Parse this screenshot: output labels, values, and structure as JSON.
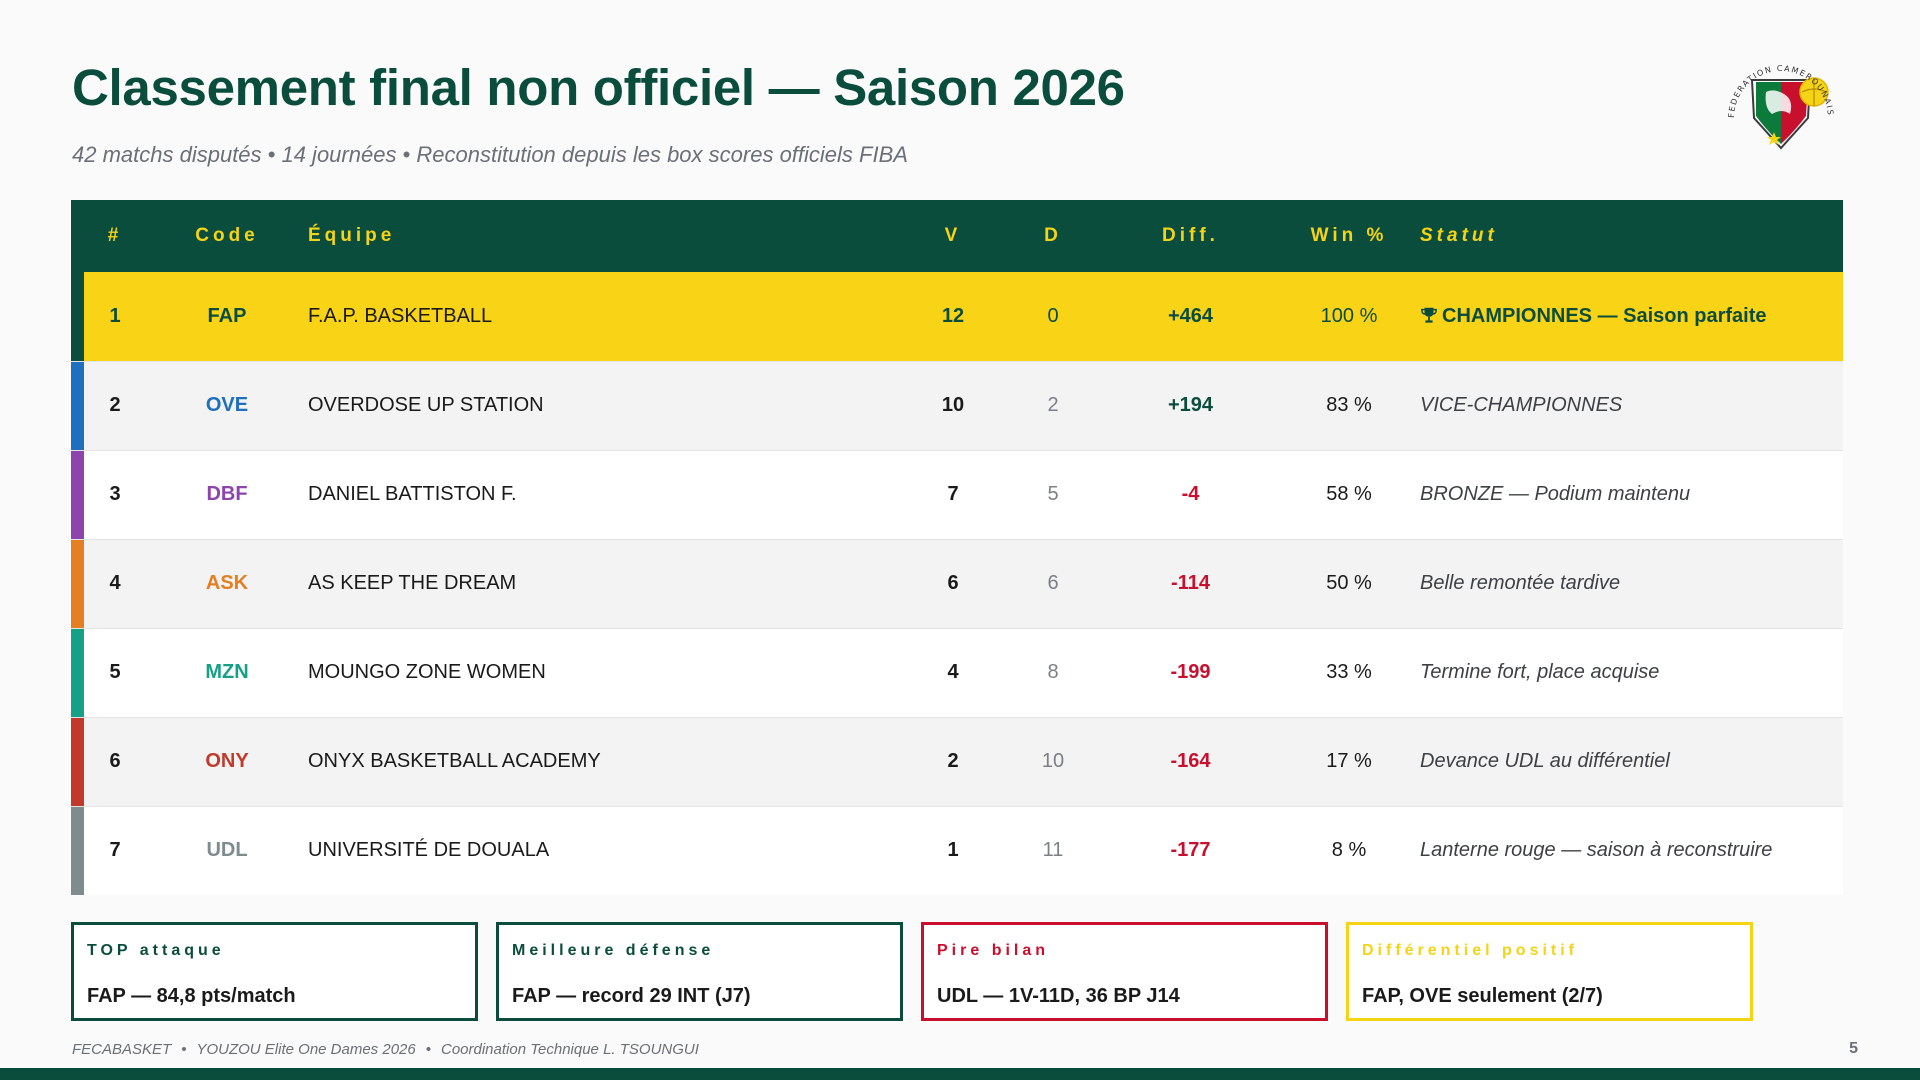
{
  "title": "Classement final non officiel — Saison 2026",
  "subtitle": "42 matchs disputés • 14 journées • Reconstitution depuis les box scores officiels FIBA",
  "logo": {
    "icon": "fecabasket-logo",
    "ring_text": "FEDERATION CAMEROUNAISE DE BASKETBALL",
    "colors": [
      "#0b7a3a",
      "#c8102e",
      "#f5d415"
    ]
  },
  "table": {
    "headers": {
      "rank": "#",
      "code": "Code",
      "team": "Équipe",
      "v": "V",
      "d": "D",
      "diff": "Diff.",
      "win": "Win %",
      "status": "Statut"
    },
    "rows": [
      {
        "rank": "1",
        "code": "FAP",
        "team": "F.A.P. BASKETBALL",
        "v": "12",
        "d": "0",
        "diff": "+464",
        "win": "100 %",
        "status": "CHAMPIONNES — Saison parfaite",
        "color": "#0b4d3c",
        "sign": "pos",
        "icon": "trophy-icon"
      },
      {
        "rank": "2",
        "code": "OVE",
        "team": "OVERDOSE UP STATION",
        "v": "10",
        "d": "2",
        "diff": "+194",
        "win": "83 %",
        "status": "VICE-CHAMPIONNES",
        "color": "#1f6fbf",
        "sign": "pos"
      },
      {
        "rank": "3",
        "code": "DBF",
        "team": "DANIEL BATTISTON F.",
        "v": "7",
        "d": "5",
        "diff": "-4",
        "win": "58 %",
        "status": "BRONZE — Podium maintenu",
        "color": "#8e44ad",
        "sign": "neg"
      },
      {
        "rank": "4",
        "code": "ASK",
        "team": "AS KEEP THE DREAM",
        "v": "6",
        "d": "6",
        "diff": "-114",
        "win": "50 %",
        "status": "Belle remontée tardive",
        "color": "#e67e22",
        "sign": "neg"
      },
      {
        "rank": "5",
        "code": "MZN",
        "team": "MOUNGO ZONE WOMEN",
        "v": "4",
        "d": "8",
        "diff": "-199",
        "win": "33 %",
        "status": "Termine fort, place acquise",
        "color": "#16a085",
        "sign": "neg"
      },
      {
        "rank": "6",
        "code": "ONY",
        "team": "ONYX BASKETBALL ACADEMY",
        "v": "2",
        "d": "10",
        "diff": "-164",
        "win": "17 %",
        "status": "Devance UDL au différentiel",
        "color": "#c0392b",
        "sign": "neg"
      },
      {
        "rank": "7",
        "code": "UDL",
        "team": "UNIVERSITÉ DE DOUALA",
        "v": "1",
        "d": "11",
        "diff": "-177",
        "win": "8 %",
        "status": "Lanterne rouge — saison à reconstruire",
        "color": "#7f8c8d",
        "sign": "neg"
      }
    ]
  },
  "cards": [
    {
      "label": "TOP attaque",
      "value": "FAP — 84,8 pts/match",
      "color": "#0b4d3c"
    },
    {
      "label": "Meilleure défense",
      "value": "FAP — record 29 INT (J7)",
      "color": "#0b4d3c"
    },
    {
      "label": "Pire bilan",
      "value": "UDL — 1V-11D, 36 BP J14",
      "color": "#c8102e"
    },
    {
      "label": "Différentiel positif",
      "value": "FAP, OVE seulement (2/7)",
      "color": "#f5d415"
    }
  ],
  "footer": {
    "parts": [
      "FECABASKET",
      "YOUZOU Elite One Dames 2026",
      "Coordination Technique L. TSOUNGUI"
    ],
    "separator": "•",
    "page": "5"
  }
}
